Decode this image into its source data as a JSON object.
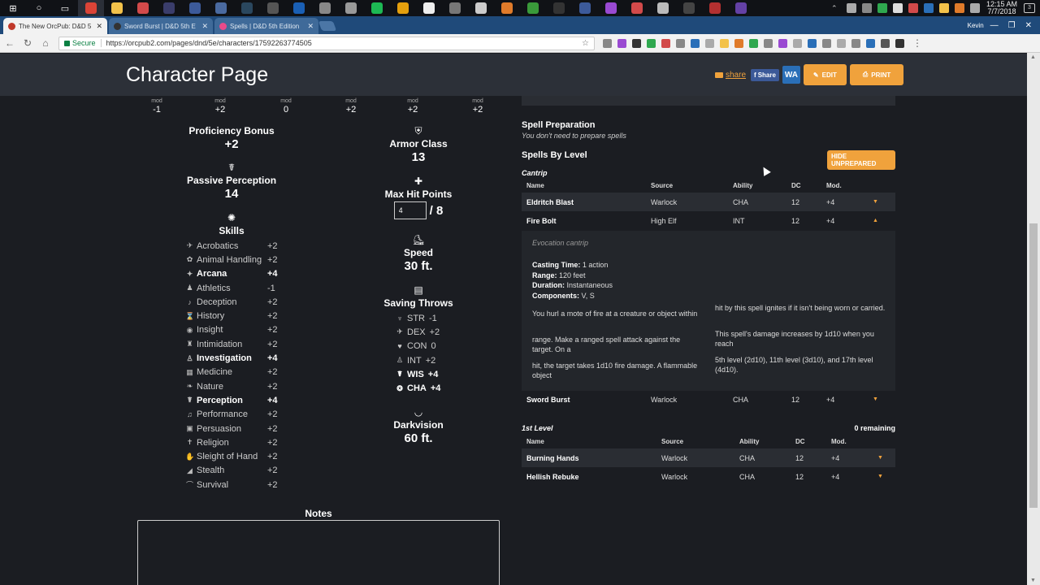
{
  "taskbar": {
    "icons": [
      {
        "name": "windows-start-icon",
        "glyph": "⊞",
        "color": "#ffffff"
      },
      {
        "name": "cortana-icon",
        "glyph": "○",
        "color": "#ffffff"
      },
      {
        "name": "task-view-icon",
        "glyph": "▭",
        "color": "#ffffff"
      },
      {
        "name": "chrome-icon",
        "glyph": "",
        "color": "#db4437",
        "active": true
      },
      {
        "name": "file-explorer-icon",
        "glyph": "",
        "color": "#f3c24a"
      },
      {
        "name": "app-icon-6",
        "glyph": "",
        "color": "#d24a4a"
      },
      {
        "name": "app-icon-7",
        "glyph": "",
        "color": "#3a3d6b"
      },
      {
        "name": "app-icon-8",
        "glyph": "",
        "color": "#3c5a9a"
      },
      {
        "name": "app-icon-9",
        "glyph": "",
        "color": "#4a6aa0"
      },
      {
        "name": "steam-icon",
        "glyph": "",
        "color": "#2a475e"
      },
      {
        "name": "app-icon-11",
        "glyph": "",
        "color": "#555555"
      },
      {
        "name": "app-icon-12",
        "glyph": "",
        "color": "#1a5fb4"
      },
      {
        "name": "app-icon-13",
        "glyph": "",
        "color": "#888888"
      },
      {
        "name": "overwatch-icon",
        "glyph": "",
        "color": "#999999"
      },
      {
        "name": "spotify-icon",
        "glyph": "",
        "color": "#1db954"
      },
      {
        "name": "plex-icon",
        "glyph": "",
        "color": "#e5a00d"
      },
      {
        "name": "app-icon-17",
        "glyph": "",
        "color": "#eeeeee"
      },
      {
        "name": "app-icon-18",
        "glyph": "",
        "color": "#777777"
      },
      {
        "name": "app-icon-19",
        "glyph": "",
        "color": "#cccccc"
      },
      {
        "name": "app-icon-20",
        "glyph": "",
        "color": "#e07b2a"
      },
      {
        "name": "app-icon-21",
        "glyph": "",
        "color": "#3a9a3a"
      },
      {
        "name": "app-icon-22",
        "glyph": "",
        "color": "#333333"
      },
      {
        "name": "app-icon-23",
        "glyph": "",
        "color": "#3c5a9a"
      },
      {
        "name": "app-icon-24",
        "glyph": "",
        "color": "#9a4ad2"
      },
      {
        "name": "app-icon-25",
        "glyph": "",
        "color": "#d24a4a"
      },
      {
        "name": "app-icon-26",
        "glyph": "",
        "color": "#bbbbbb"
      },
      {
        "name": "epic-games-icon",
        "glyph": "",
        "color": "#444444"
      },
      {
        "name": "app-icon-28",
        "glyph": "",
        "color": "#b33030"
      },
      {
        "name": "twitch-icon",
        "glyph": "",
        "color": "#6441a5"
      }
    ],
    "tray_colors": [
      "#aaaaaa",
      "#888888",
      "#2fa84f",
      "#dddddd",
      "#d24a4a",
      "#2a6fb8",
      "#f3c24a",
      "#e07b2a",
      "#aaaaaa"
    ],
    "clock_time": "12:15 AM",
    "clock_date": "7/7/2018",
    "notification_count": "3"
  },
  "browser": {
    "tabs": [
      {
        "title": "The New OrcPub: D&D 5",
        "favicon_color": "#c0392b",
        "active": true
      },
      {
        "title": "Sword Burst | D&D 5th E",
        "favicon_color": "#333333",
        "active": false
      },
      {
        "title": "Spells | D&D 5th Edition",
        "favicon_color": "#e84a8a",
        "active": false
      }
    ],
    "profile": "Kevin",
    "secure_label": "Secure",
    "url": "https://orcpub2.com/pages/dnd/5e/characters/17592263774505",
    "extension_colors": [
      "#888888",
      "#9a4ad2",
      "#333333",
      "#2fa84f",
      "#d24a4a",
      "#888888",
      "#2a6fb8",
      "#aaaaaa",
      "#f3c24a",
      "#e07b2a",
      "#2fa84f",
      "#888888",
      "#9a4ad2",
      "#aaaaaa",
      "#2a6fb8",
      "#888888",
      "#aaaaaa",
      "#888888",
      "#2a6fb8",
      "#555555",
      "#333333"
    ]
  },
  "header": {
    "title": "Character Page",
    "share_label": "share",
    "fb_share_label": "Share",
    "wa_label": "WA",
    "edit_label": "EDIT",
    "print_label": "PRINT"
  },
  "ability_mods": [
    {
      "label": "mod",
      "value": "-1"
    },
    {
      "label": "mod",
      "value": "+2"
    },
    {
      "label": "mod",
      "value": "0"
    },
    {
      "label": "mod",
      "value": "+2"
    },
    {
      "label": "mod",
      "value": "+2"
    },
    {
      "label": "mod",
      "value": "+2"
    }
  ],
  "stats": {
    "proficiency_label": "Proficiency Bonus",
    "proficiency_value": "+2",
    "passive_label": "Passive Perception",
    "passive_value": "14",
    "skills_label": "Skills",
    "ac_label": "Armor Class",
    "ac_value": "13",
    "hp_label": "Max Hit Points",
    "hp_current": "4",
    "hp_max": "/ 8",
    "speed_label": "Speed",
    "speed_value": "30 ft.",
    "saves_label": "Saving Throws",
    "darkvision_label": "Darkvision",
    "darkvision_value": "60 ft."
  },
  "skills": [
    {
      "name": "Acrobatics",
      "value": "+2",
      "proficient": false,
      "icon": "acrobatics-icon",
      "glyph": "✈"
    },
    {
      "name": "Animal Handling",
      "value": "+2",
      "proficient": false,
      "icon": "animal-handling-icon",
      "glyph": "✿"
    },
    {
      "name": "Arcana",
      "value": "+4",
      "proficient": true,
      "icon": "arcana-icon",
      "glyph": "✦"
    },
    {
      "name": "Athletics",
      "value": "-1",
      "proficient": false,
      "icon": "athletics-icon",
      "glyph": "♟"
    },
    {
      "name": "Deception",
      "value": "+2",
      "proficient": false,
      "icon": "deception-icon",
      "glyph": "♪"
    },
    {
      "name": "History",
      "value": "+2",
      "proficient": false,
      "icon": "history-icon",
      "glyph": "⌛"
    },
    {
      "name": "Insight",
      "value": "+2",
      "proficient": false,
      "icon": "insight-icon",
      "glyph": "◉"
    },
    {
      "name": "Intimidation",
      "value": "+2",
      "proficient": false,
      "icon": "intimidation-icon",
      "glyph": "♜"
    },
    {
      "name": "Investigation",
      "value": "+4",
      "proficient": true,
      "icon": "investigation-icon",
      "glyph": "♙"
    },
    {
      "name": "Medicine",
      "value": "+2",
      "proficient": false,
      "icon": "medicine-icon",
      "glyph": "▦"
    },
    {
      "name": "Nature",
      "value": "+2",
      "proficient": false,
      "icon": "nature-icon",
      "glyph": "❧"
    },
    {
      "name": "Perception",
      "value": "+4",
      "proficient": true,
      "icon": "perception-icon",
      "glyph": "☤"
    },
    {
      "name": "Performance",
      "value": "+2",
      "proficient": false,
      "icon": "performance-icon",
      "glyph": "♫"
    },
    {
      "name": "Persuasion",
      "value": "+2",
      "proficient": false,
      "icon": "persuasion-icon",
      "glyph": "▣"
    },
    {
      "name": "Religion",
      "value": "+2",
      "proficient": false,
      "icon": "religion-icon",
      "glyph": "✝"
    },
    {
      "name": "Sleight of Hand",
      "value": "+2",
      "proficient": false,
      "icon": "sleight-of-hand-icon",
      "glyph": "✋"
    },
    {
      "name": "Stealth",
      "value": "+2",
      "proficient": false,
      "icon": "stealth-icon",
      "glyph": "◢"
    },
    {
      "name": "Survival",
      "value": "+2",
      "proficient": false,
      "icon": "survival-icon",
      "glyph": "⌒"
    }
  ],
  "saves": [
    {
      "name": "STR",
      "value": "-1",
      "proficient": false,
      "icon": "str-save-icon",
      "glyph": "♆"
    },
    {
      "name": "DEX",
      "value": "+2",
      "proficient": false,
      "icon": "dex-save-icon",
      "glyph": "✈"
    },
    {
      "name": "CON",
      "value": "0",
      "proficient": false,
      "icon": "con-save-icon",
      "glyph": "♥"
    },
    {
      "name": "INT",
      "value": "+2",
      "proficient": false,
      "icon": "int-save-icon",
      "glyph": "♙"
    },
    {
      "name": "WIS",
      "value": "+4",
      "proficient": true,
      "icon": "wis-save-icon",
      "glyph": "☤"
    },
    {
      "name": "CHA",
      "value": "+4",
      "proficient": true,
      "icon": "cha-save-icon",
      "glyph": "❂"
    }
  ],
  "notes": {
    "title": "Notes"
  },
  "spells": {
    "prep_heading": "Spell Preparation",
    "prep_sub": "You don't need to prepare spells",
    "by_level_heading": "Spells By Level",
    "hide_unprepared": "HIDE UNPREPARED",
    "cantrip_title": "Cantrip",
    "first_level_title": "1st Level",
    "first_level_remaining": "0 remaining",
    "columns": {
      "name": "Name",
      "source": "Source",
      "ability": "Ability",
      "dc": "DC",
      "mod": "Mod."
    },
    "cantrips": [
      {
        "name": "Eldritch Blast",
        "source": "Warlock",
        "ability": "CHA",
        "dc": "12",
        "mod": "+4",
        "chevron": "▼"
      },
      {
        "name": "Fire Bolt",
        "source": "High Elf",
        "ability": "INT",
        "dc": "12",
        "mod": "+4",
        "chevron": "▲"
      },
      {
        "name": "Sword Burst",
        "source": "Warlock",
        "ability": "CHA",
        "dc": "12",
        "mod": "+4",
        "chevron": "▼"
      }
    ],
    "first_level": [
      {
        "name": "Burning Hands",
        "source": "Warlock",
        "ability": "CHA",
        "dc": "12",
        "mod": "+4",
        "chevron": "▼"
      },
      {
        "name": "Hellish Rebuke",
        "source": "Warlock",
        "ability": "CHA",
        "dc": "12",
        "mod": "+4",
        "chevron": "▼"
      }
    ],
    "detail": {
      "school": "Evocation cantrip",
      "casting_time_label": "Casting Time:",
      "casting_time": "1 action",
      "range_label": "Range:",
      "range": "120 feet",
      "duration_label": "Duration:",
      "duration": "Instantaneous",
      "components_label": "Components:",
      "components": "V, S",
      "left_paragraphs": [
        "You hurl a mote of fire at a creature or object within",
        "range. Make a ranged spell attack against the target. On a",
        "hit, the target takes 1d10 fire damage. A flammable object"
      ],
      "right_paragraphs": [
        "hit by this spell ignites if it isn't being worn or carried.",
        "This spell's damage increases by 1d10 when you reach",
        "5th level (2d10), 11th level (3d10), and 17th level (4d10)."
      ]
    }
  },
  "colors": {
    "accent": "#f0a23c",
    "page_bg": "#1b1d22",
    "header_bg": "#2c3038"
  }
}
